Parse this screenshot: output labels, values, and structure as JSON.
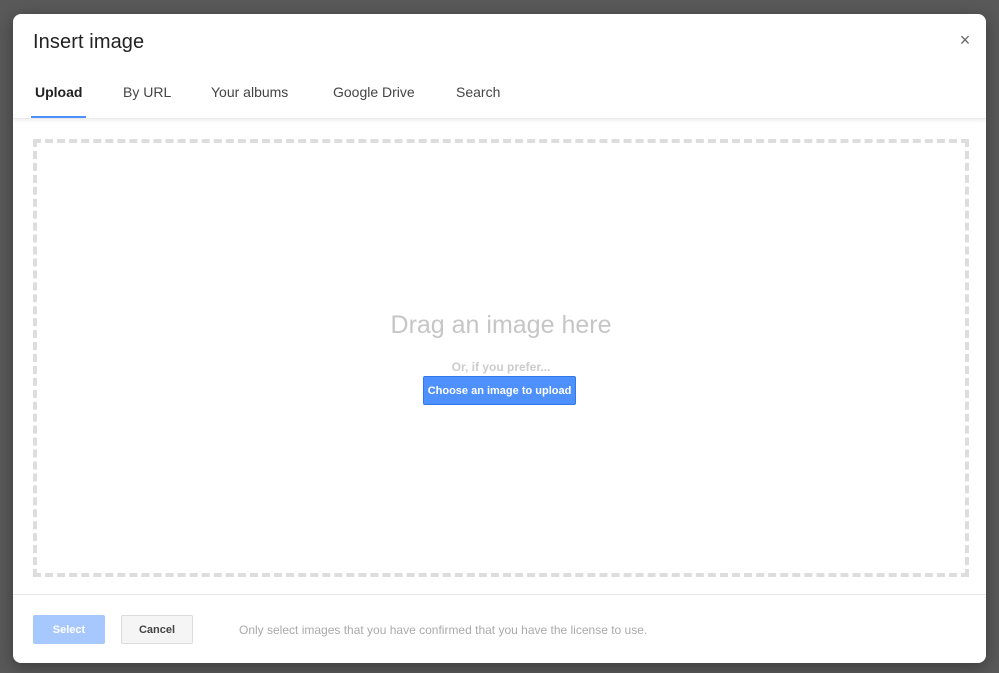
{
  "dialog": {
    "title": "Insert image",
    "close_icon": "×"
  },
  "tabs": [
    {
      "label": "Upload",
      "active": true
    },
    {
      "label": "By URL",
      "active": false
    },
    {
      "label": "Your albums",
      "active": false
    },
    {
      "label": "Google Drive",
      "active": false
    },
    {
      "label": "Search",
      "active": false
    }
  ],
  "dropzone": {
    "heading": "Drag an image here",
    "subtext": "Or, if you prefer...",
    "choose_button": "Choose an image to upload"
  },
  "footer": {
    "select_label": "Select",
    "cancel_label": "Cancel",
    "license_note": "Only select images that you have confirmed that you have the license to use."
  },
  "colors": {
    "accent": "#4d90fe",
    "select_disabled": "#a6c8ff",
    "backdrop": "#595959"
  }
}
